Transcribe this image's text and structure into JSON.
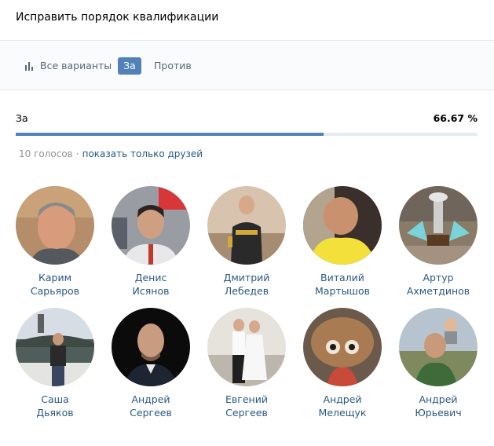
{
  "header": {
    "title": "Исправить порядок квалификации"
  },
  "tabs": [
    {
      "label": "Все варианты",
      "icon": "bar-chart-icon"
    },
    {
      "label": "За"
    },
    {
      "label": "Против"
    }
  ],
  "result": {
    "label": "За",
    "percent": "66.67 %",
    "fill": 0.6667
  },
  "meta": {
    "votes": "10 голосов",
    "separator": "·",
    "friends_link": "показать только друзей"
  },
  "voters": [
    {
      "first": "Карим",
      "last": "Сарьяров"
    },
    {
      "first": "Денис",
      "last": "Исянов"
    },
    {
      "first": "Дмитрий",
      "last": "Лебедев"
    },
    {
      "first": "Виталий",
      "last": "Мартышов"
    },
    {
      "first": "Артур",
      "last": "Ахметдинов"
    },
    {
      "first": "Саша",
      "last": "Дьяков"
    },
    {
      "first": "Андрей",
      "last": "Сергеев"
    },
    {
      "first": "Евгений",
      "last": "Сергеев"
    },
    {
      "first": "Андрей",
      "last": "Мелещук"
    },
    {
      "first": "Андрей",
      "last": "Юрьевич"
    }
  ],
  "colors": {
    "accent": "#5181b8",
    "link": "#2a5885",
    "muted": "#939393"
  }
}
